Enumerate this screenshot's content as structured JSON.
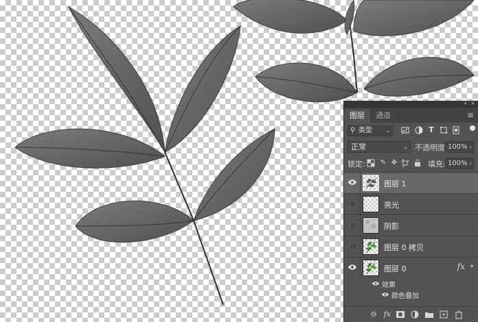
{
  "panel": {
    "tabs": [
      {
        "label": "图层",
        "active": true
      },
      {
        "label": "通道",
        "active": false
      }
    ],
    "filter": {
      "kind_label": "类型",
      "icons": [
        "image-filter-icon",
        "adjustment-filter-icon",
        "type-filter-icon",
        "shape-filter-icon",
        "smart-object-filter-icon"
      ]
    },
    "blend": {
      "mode": "正常",
      "opacity_label": "不透明度:",
      "opacity_value": "100%"
    },
    "lock": {
      "label": "锁定:",
      "fill_label": "填充:",
      "fill_value": "100%"
    },
    "layers": [
      {
        "name": "图层 1",
        "visible": true,
        "selected": true,
        "thumb": "leaf-gray"
      },
      {
        "name": "亮光",
        "visible": false,
        "selected": false,
        "thumb": "transparent"
      },
      {
        "name": "阴影",
        "visible": false,
        "selected": false,
        "thumb": "noise"
      },
      {
        "name": "图层 0 拷贝",
        "visible": false,
        "selected": false,
        "thumb": "leaf-green"
      },
      {
        "name": "图层 0",
        "visible": true,
        "selected": false,
        "thumb": "leaf-green",
        "fx": "fx"
      }
    ],
    "effects": {
      "label": "效果",
      "items": [
        "颜色叠加"
      ]
    },
    "bottom_icons": [
      "link-icon",
      "fx-icon",
      "mask-icon",
      "adjustment-icon",
      "folder-icon",
      "new-layer-icon",
      "trash-icon"
    ],
    "bottom_fx_label": "fx"
  },
  "colors": {
    "panel_bg": "#535353",
    "selected_row": "#686868",
    "leaf_fill": "#6e6e6e",
    "leaf_dark": "#3a3a3a",
    "thumb_leaf_green": "#3f8a2a"
  }
}
